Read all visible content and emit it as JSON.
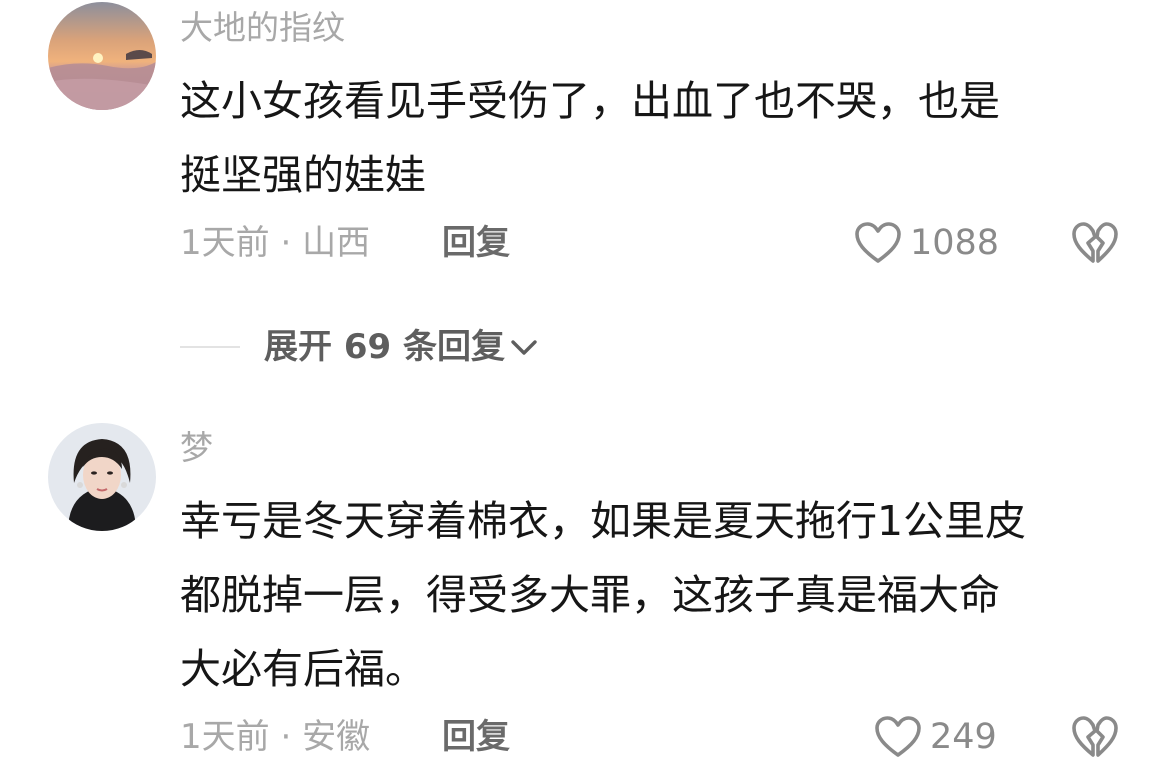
{
  "comments": [
    {
      "username": "大地的指纹",
      "text_lines": [
        "这小女孩看见手受伤了，出血了也不哭，也是",
        "挺坚强的娃娃"
      ],
      "time": "1天前",
      "separator": "·",
      "location": "山西",
      "reply_label": "回复",
      "like_count": "1088",
      "avatar": "sunset-landscape"
    },
    {
      "username": "梦",
      "text_lines": [
        "幸亏是冬天穿着棉衣，如果是夏天拖行1公里皮",
        "都脱掉一层，得受多大罪，这孩子真是福大命",
        "大必有后福。"
      ],
      "time": "1天前",
      "separator": "·",
      "location": "安徽",
      "reply_label": "回复",
      "like_count": "249",
      "avatar": "woman-portrait"
    }
  ],
  "expand_replies": {
    "label": "展开 69 条回复",
    "icon": "chevron-down-icon"
  },
  "icons": {
    "like": "heart-outline-icon",
    "dislike": "broken-heart-icon"
  },
  "colors": {
    "text_primary": "#161616",
    "text_secondary": "#a8a8a8",
    "reply": "#6a6a6a",
    "background": "#ffffff"
  }
}
